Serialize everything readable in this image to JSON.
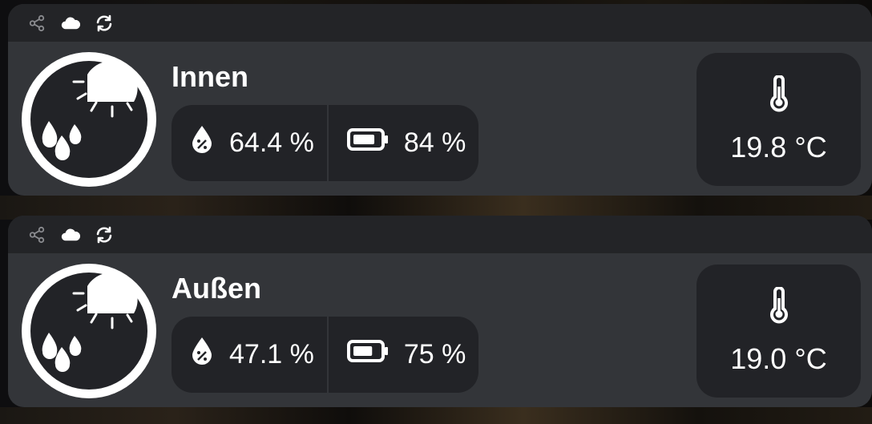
{
  "sensors": [
    {
      "name": "Innen",
      "humidity": "64.4 %",
      "battery": "84 %",
      "battery_level": 84,
      "temperature": "19.8 °C",
      "icons": [
        "share-icon",
        "cloud-icon",
        "refresh-icon",
        "weather-partly-rainy-icon",
        "humidity-drop-icon",
        "battery-icon",
        "thermometer-icon"
      ]
    },
    {
      "name": "Außen",
      "humidity": "47.1 %",
      "battery": "75 %",
      "battery_level": 75,
      "temperature": "19.0 °C",
      "icons": [
        "share-icon",
        "cloud-icon",
        "refresh-icon",
        "weather-partly-rainy-icon",
        "humidity-drop-icon",
        "battery-icon",
        "thermometer-icon"
      ]
    }
  ],
  "colors": {
    "card": "#333539",
    "card_header": "#232427",
    "pill": "#222327",
    "text": "#ffffff",
    "muted_icon": "#8a8b8f"
  }
}
